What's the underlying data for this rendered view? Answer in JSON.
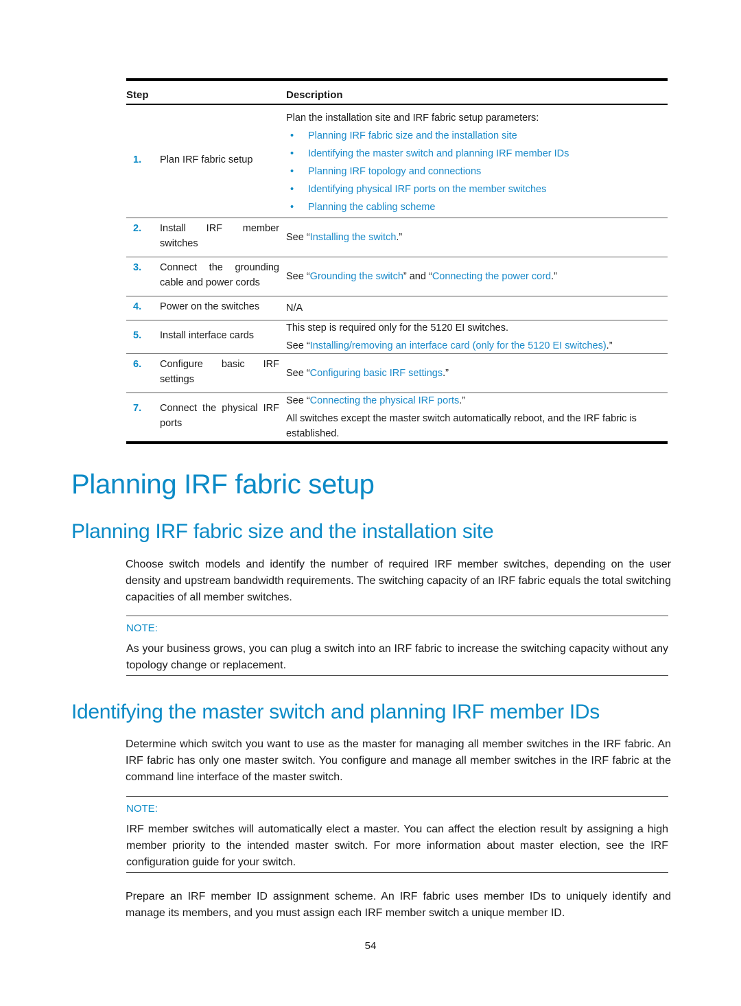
{
  "table": {
    "headers": {
      "step": "Step",
      "description": "Description"
    },
    "rows": [
      {
        "num": "1.",
        "step": "Plan IRF fabric setup",
        "intro": "Plan the installation site and IRF fabric setup parameters:",
        "bullets": [
          "Planning IRF fabric size and the installation site",
          "Identifying the master switch and planning IRF member IDs",
          "Planning IRF topology and connections",
          "Identifying physical IRF ports on the member switches",
          "Planning the cabling scheme"
        ]
      },
      {
        "num": "2.",
        "step": "Install IRF member switches",
        "pre": "See “",
        "link": "Installing the switch",
        "post": ".”"
      },
      {
        "num": "3.",
        "step": "Connect the grounding cable and power cords",
        "pre": "See “",
        "link": "Grounding the switch",
        "mid": "” and “",
        "link2": "Connecting the power cord",
        "post": ".”"
      },
      {
        "num": "4.",
        "step": "Power on the switches",
        "text": "N/A"
      },
      {
        "num": "5.",
        "step": "Install interface cards",
        "text": "This step is required only for the 5120 EI switches.",
        "pre": "See “",
        "link": "Installing/removing an interface card (only for the 5120 EI switches)",
        "post": ".”"
      },
      {
        "num": "6.",
        "step": "Configure basic IRF settings",
        "pre": "See “",
        "link": "Configuring basic IRF settings",
        "post": ".”"
      },
      {
        "num": "7.",
        "step": "Connect the physical IRF ports",
        "pre": "See “",
        "link": "Connecting the physical IRF ports",
        "post": ".”",
        "text": "All switches except the master switch automatically reboot, and the IRF fabric is established."
      }
    ]
  },
  "section": {
    "title": "Planning IRF fabric setup",
    "sub1": {
      "title": "Planning IRF fabric size and the installation site",
      "para": "Choose switch models and identify the number of required IRF member switches, depending on the user density and upstream bandwidth requirements. The switching capacity of an IRF fabric equals the total switching capacities of all member switches.",
      "note_label": "NOTE:",
      "note_text": "As your business grows, you can plug a switch into an IRF fabric to increase the switching capacity without any topology change or replacement."
    },
    "sub2": {
      "title": "Identifying the master switch and planning IRF member IDs",
      "para": "Determine which switch you want to use as the master for managing all member switches in the IRF fabric. An IRF fabric has only one master switch. You configure and manage all member switches in the IRF fabric at the command line interface of the master switch.",
      "note_label": "NOTE:",
      "note_text": "IRF member switches will automatically elect a master. You can affect the election result by assigning a high member priority to the intended master switch. For more information about master election, see the IRF configuration guide for your switch.",
      "para2": "Prepare an IRF member ID assignment scheme. An IRF fabric uses member IDs to uniquely identify and manage its members, and you must assign each IRF member switch a unique member ID."
    }
  },
  "page_number": "54"
}
